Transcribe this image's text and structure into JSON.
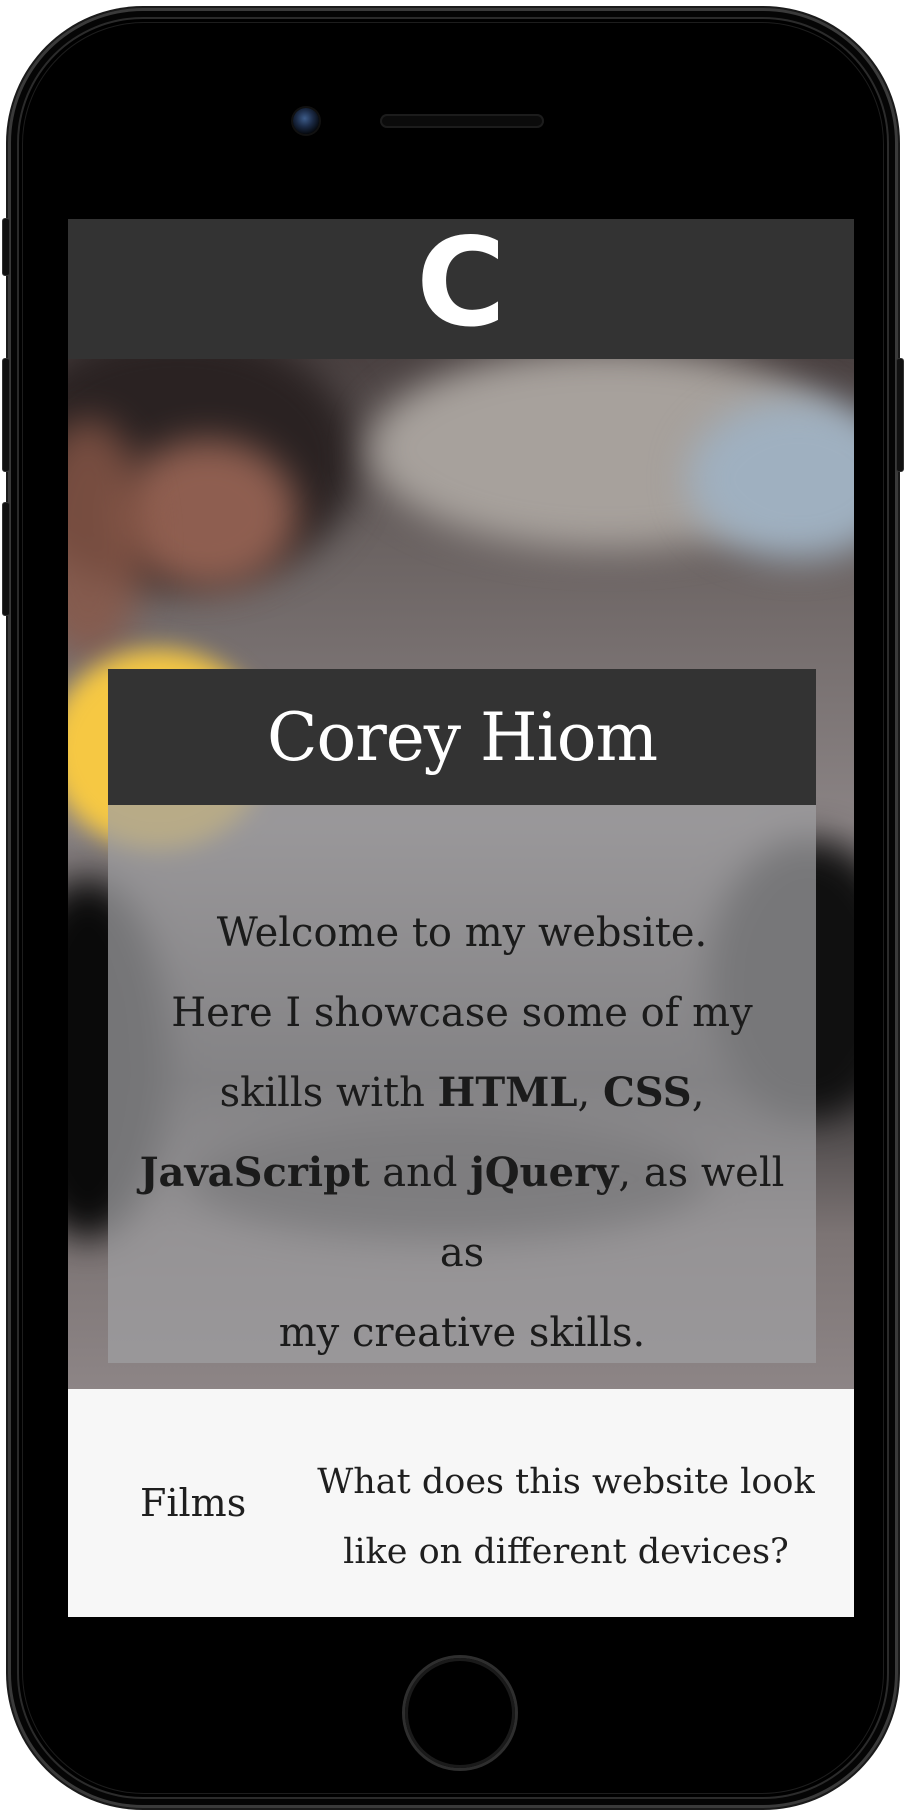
{
  "app": {
    "logo_letter": "C",
    "colors": {
      "header_bg": "#333333",
      "title_bg": "#333333",
      "nav_bg": "#f7f7f7",
      "text_dark": "#1b1b1b",
      "text_light": "#ffffff"
    }
  },
  "hero": {
    "title": "Corey Hiom",
    "intro": {
      "line1": "Welcome to my website.",
      "line2": "Here I showcase some of my",
      "skills_prefix": "skills with ",
      "skill_html": "HTML",
      "comma1": ", ",
      "skill_css": "CSS",
      "comma2": ",",
      "skill_js": "JavaScript",
      "and": " and ",
      "skill_jquery": "jQuery",
      "suffix": ", as well as",
      "line5": "my creative skills."
    }
  },
  "nav": {
    "films_label": "Films",
    "devices_line1": "What does this website look",
    "devices_line2": "like on different devices?"
  },
  "icons": {
    "logo": "letter-c-logo",
    "camera": "front-camera-icon",
    "speaker": "earpiece-speaker-icon",
    "home": "home-button-icon"
  }
}
